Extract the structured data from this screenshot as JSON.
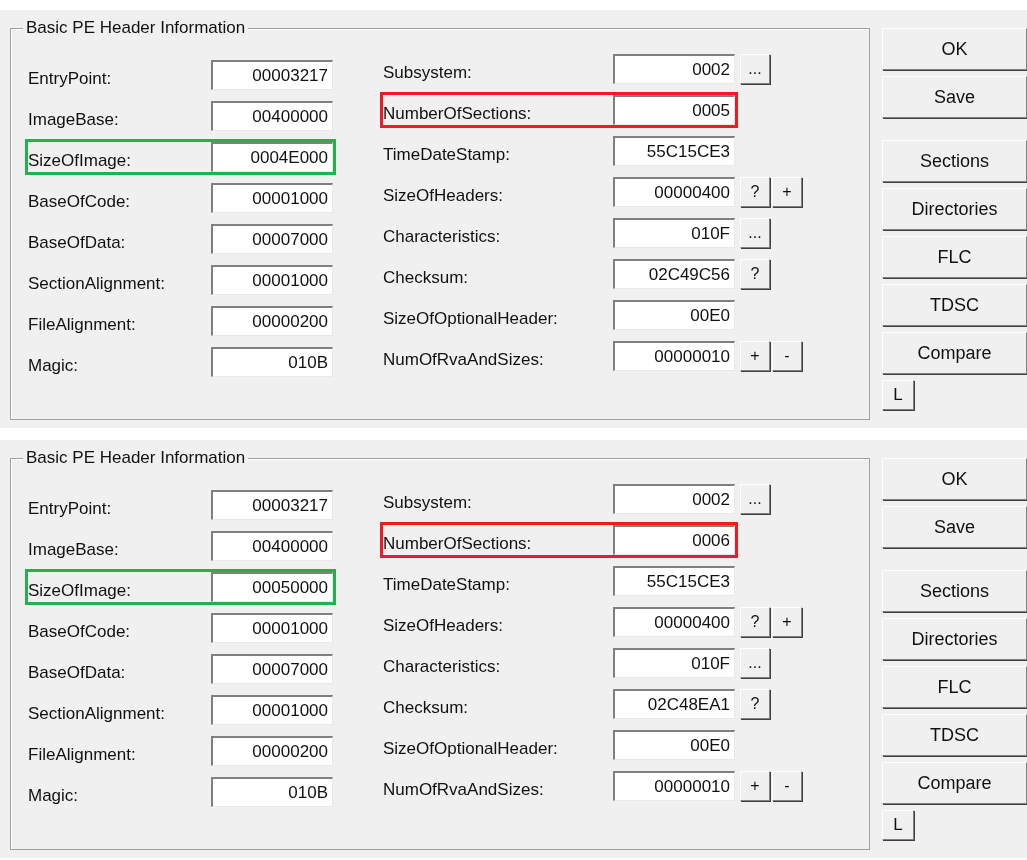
{
  "panels": [
    {
      "group_title": "Basic PE Header Information",
      "left_fields": [
        {
          "label": "EntryPoint:",
          "value": "00003217"
        },
        {
          "label": "ImageBase:",
          "value": "00400000"
        },
        {
          "label": "SizeOfImage:",
          "value": "0004E000",
          "highlight": {
            "color": "#22b14c"
          }
        },
        {
          "label": "BaseOfCode:",
          "value": "00001000"
        },
        {
          "label": "BaseOfData:",
          "value": "00007000"
        },
        {
          "label": "SectionAlignment:",
          "value": "00001000"
        },
        {
          "label": "FileAlignment:",
          "value": "00000200"
        },
        {
          "label": "Magic:",
          "value": "010B"
        }
      ],
      "right_fields": [
        {
          "label": "Subsystem:",
          "value": "0002",
          "buttons": [
            "..."
          ]
        },
        {
          "label": "NumberOfSections:",
          "value": "0005",
          "highlight": {
            "color": "#ed1c24"
          }
        },
        {
          "label": "TimeDateStamp:",
          "value": "55C15CE3"
        },
        {
          "label": "SizeOfHeaders:",
          "value": "00000400",
          "buttons": [
            "?",
            "+"
          ]
        },
        {
          "label": "Characteristics:",
          "value": "010F",
          "buttons": [
            "..."
          ]
        },
        {
          "label": "Checksum:",
          "value": "02C49C56",
          "buttons": [
            "?"
          ]
        },
        {
          "label": "SizeOfOptionalHeader:",
          "value": "00E0"
        },
        {
          "label": "NumOfRvaAndSizes:",
          "value": "00000010",
          "buttons": [
            "+",
            "-"
          ]
        }
      ],
      "button_groups": [
        [
          {
            "label": "OK",
            "kind": "wide"
          },
          {
            "label": "Save",
            "kind": "wide"
          }
        ],
        [
          {
            "label": "Sections",
            "kind": "wide"
          },
          {
            "label": "Directories",
            "kind": "wide"
          },
          {
            "label": "FLC",
            "kind": "wide"
          },
          {
            "label": "TDSC",
            "kind": "wide"
          },
          {
            "label": "Compare",
            "kind": "wide"
          },
          {
            "label": "L",
            "kind": "small"
          }
        ]
      ]
    },
    {
      "group_title": "Basic PE Header Information",
      "left_fields": [
        {
          "label": "EntryPoint:",
          "value": "00003217"
        },
        {
          "label": "ImageBase:",
          "value": "00400000"
        },
        {
          "label": "SizeOfImage:",
          "value": "00050000",
          "highlight": {
            "color": "#22b14c"
          }
        },
        {
          "label": "BaseOfCode:",
          "value": "00001000"
        },
        {
          "label": "BaseOfData:",
          "value": "00007000"
        },
        {
          "label": "SectionAlignment:",
          "value": "00001000"
        },
        {
          "label": "FileAlignment:",
          "value": "00000200"
        },
        {
          "label": "Magic:",
          "value": "010B"
        }
      ],
      "right_fields": [
        {
          "label": "Subsystem:",
          "value": "0002",
          "buttons": [
            "..."
          ]
        },
        {
          "label": "NumberOfSections:",
          "value": "0006",
          "highlight": {
            "color": "#ed1c24"
          }
        },
        {
          "label": "TimeDateStamp:",
          "value": "55C15CE3"
        },
        {
          "label": "SizeOfHeaders:",
          "value": "00000400",
          "buttons": [
            "?",
            "+"
          ]
        },
        {
          "label": "Characteristics:",
          "value": "010F",
          "buttons": [
            "..."
          ]
        },
        {
          "label": "Checksum:",
          "value": "02C48EA1",
          "buttons": [
            "?"
          ]
        },
        {
          "label": "SizeOfOptionalHeader:",
          "value": "00E0"
        },
        {
          "label": "NumOfRvaAndSizes:",
          "value": "00000010",
          "buttons": [
            "+",
            "-"
          ]
        }
      ],
      "button_groups": [
        [
          {
            "label": "OK",
            "kind": "wide"
          },
          {
            "label": "Save",
            "kind": "wide"
          }
        ],
        [
          {
            "label": "Sections",
            "kind": "wide"
          },
          {
            "label": "Directories",
            "kind": "wide"
          },
          {
            "label": "FLC",
            "kind": "wide"
          },
          {
            "label": "TDSC",
            "kind": "wide"
          },
          {
            "label": "Compare",
            "kind": "wide"
          },
          {
            "label": "L",
            "kind": "small"
          }
        ]
      ]
    }
  ]
}
